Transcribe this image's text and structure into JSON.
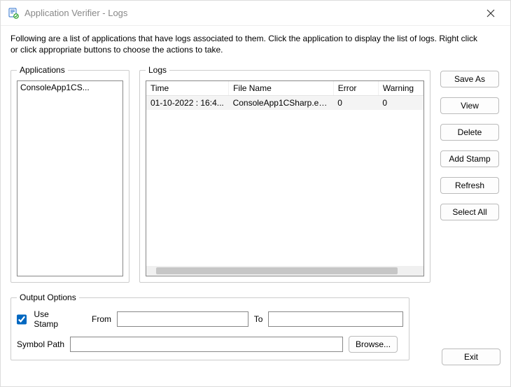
{
  "window": {
    "title": "Application Verifier - Logs"
  },
  "instructions": "Following are a list of applications that have logs associated to them. Click the application to display the list of logs. Right click or click appropriate buttons to choose the actions to take.",
  "applications": {
    "legend": "Applications",
    "items": [
      {
        "label": "ConsoleApp1CS..."
      }
    ]
  },
  "logs": {
    "legend": "Logs",
    "columns": {
      "time": "Time",
      "file": "File Name",
      "error": "Error",
      "warning": "Warning"
    },
    "rows": [
      {
        "time": "01-10-2022 : 16:4...",
        "file": "ConsoleApp1CSharp.ex...",
        "error": "0",
        "warning": "0"
      }
    ]
  },
  "buttons": {
    "save_as": "Save As",
    "view": "View",
    "delete": "Delete",
    "add_stamp": "Add Stamp",
    "refresh": "Refresh",
    "select_all": "Select All",
    "browse": "Browse...",
    "exit": "Exit"
  },
  "output": {
    "legend": "Output Options",
    "use_stamp_label": "Use Stamp",
    "from_label": "From",
    "to_label": "To",
    "symbol_path_label": "Symbol Path",
    "from_value": "",
    "to_value": "",
    "symbol_path_value": ""
  }
}
